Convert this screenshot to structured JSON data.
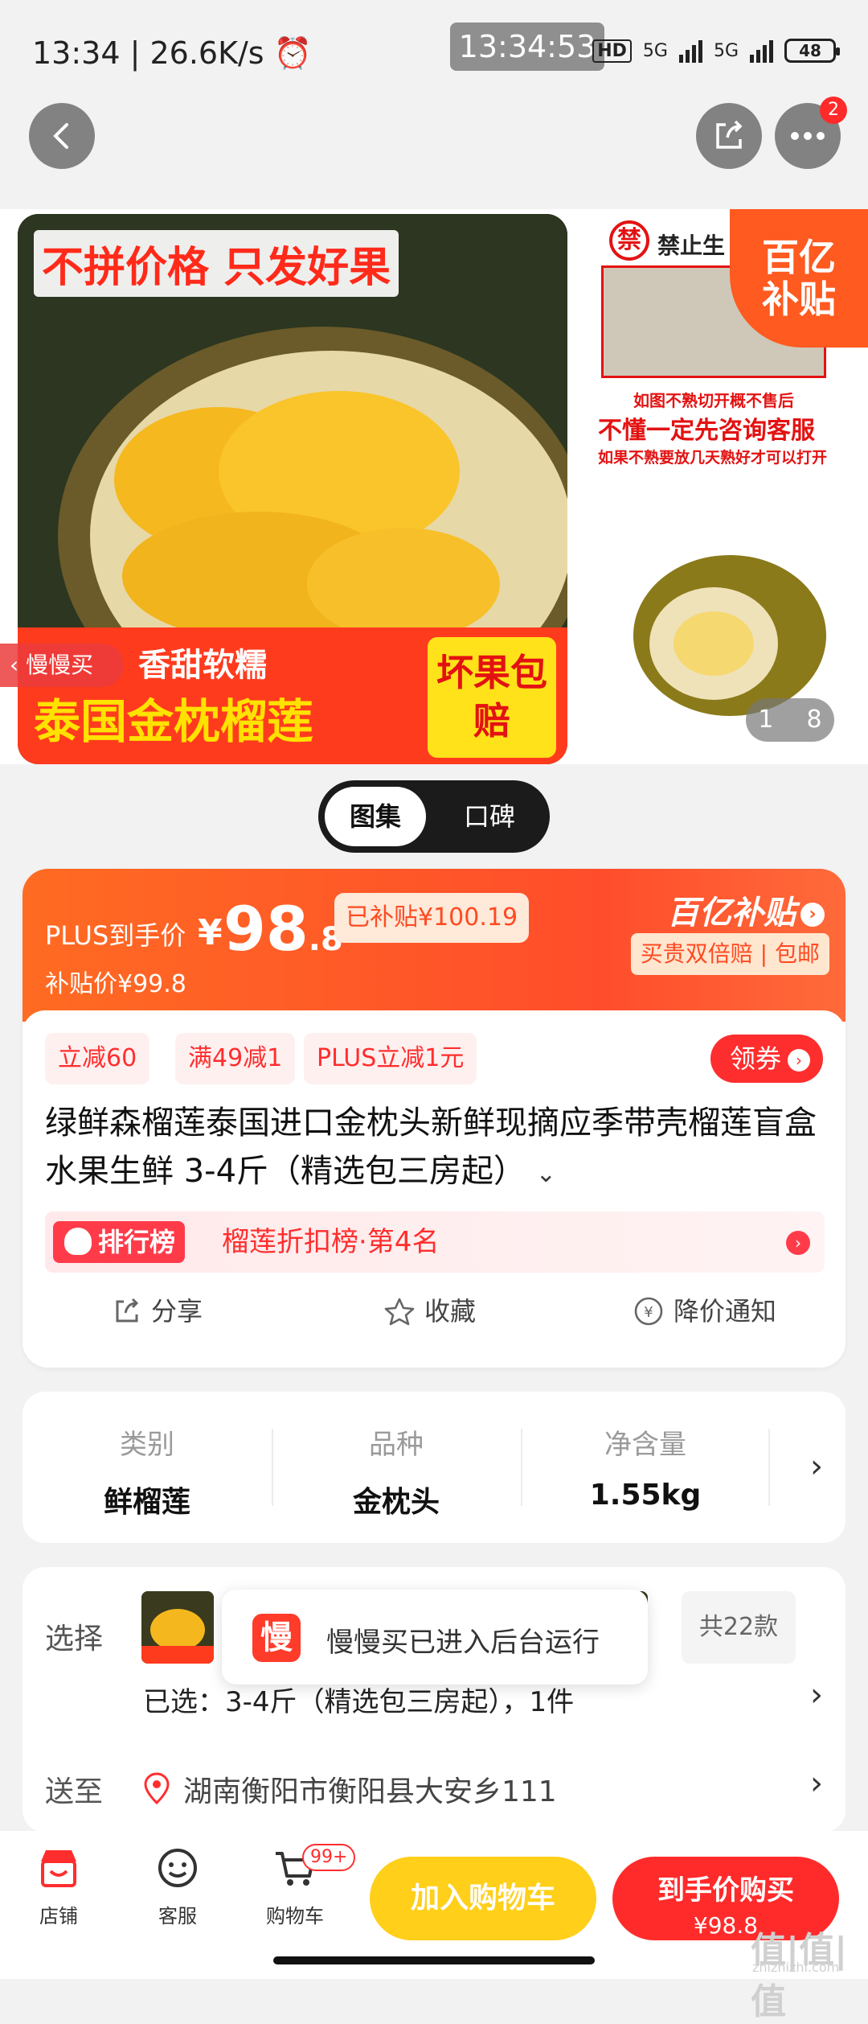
{
  "status_bar": {
    "left_text": "13:34 | 26.6K/s ⏰",
    "center_time": "13:34:53",
    "hd": "HD",
    "net1": "5G",
    "net2": "5G",
    "battery": "48"
  },
  "nav": {
    "more_badge": "2"
  },
  "gallery": {
    "main_headline": "不拼价格 只发好果",
    "main_small": "香甜软糯",
    "main_title": "泰国金枕榴莲",
    "main_corner": "坏果包赔",
    "side_ban": "禁",
    "side_warn": "禁止生",
    "side_note1": "如图不熟切开概不售后",
    "side_note2": "不懂一定先咨询客服",
    "side_note3": "如果不熟要放几天熟好才可以打开",
    "yi_badge_line1": "百亿",
    "yi_badge_line2": "补贴",
    "counter_current": "1",
    "counter_total": "8",
    "back_app": "慢慢买"
  },
  "segment": {
    "gallery": "图集",
    "reviews": "口碑"
  },
  "price": {
    "plus_label": "PLUS到手价",
    "currency": "¥",
    "price_int": "98",
    "price_dec": ".8",
    "subsidized": "已补贴¥100.19",
    "sub_price": "补贴价¥99.8",
    "yi_brand": "百亿补贴",
    "yi_tags": "买贵双倍赔 | 包邮"
  },
  "promos": [
    "立减60",
    "满49减1",
    "PLUS立减1元"
  ],
  "coupon": "领券",
  "title": "绿鲜森榴莲泰国进口金枕头新鲜现摘应季带壳榴莲盲盒水果生鲜 3-4斤（精选包三房起）",
  "rank": {
    "tag": "排行榜",
    "text": "榴莲折扣榜·第4名"
  },
  "actions": {
    "share": "分享",
    "favorite": "收藏",
    "price_alert": "降价通知"
  },
  "specs": [
    {
      "key": "类别",
      "value": "鲜榴莲"
    },
    {
      "key": "品种",
      "value": "金枕头"
    },
    {
      "key": "净含量",
      "value": "1.55kg"
    }
  ],
  "options": {
    "select_label": "选择",
    "count": "共22款",
    "selected": "已选：3-4斤（精选包三房起），1件",
    "ship_label": "送至",
    "address": "湖南衡阳市衡阳县大安乡111"
  },
  "toast": {
    "icon": "慢",
    "text": "慢慢买已进入后台运行"
  },
  "bottom": {
    "store": "店铺",
    "service": "客服",
    "cart": "购物车",
    "cart_badge": "99+",
    "add_cart": "加入购物车",
    "buy_now": "到手价购买",
    "buy_price": "¥98.8"
  },
  "watermark": {
    "main": "值|值|值",
    "small": "zhizhizhi.com"
  },
  "colors": {
    "accent": "#ff2e2e",
    "orange": "#ff5a1f",
    "yellow": "#ffcf1a"
  }
}
